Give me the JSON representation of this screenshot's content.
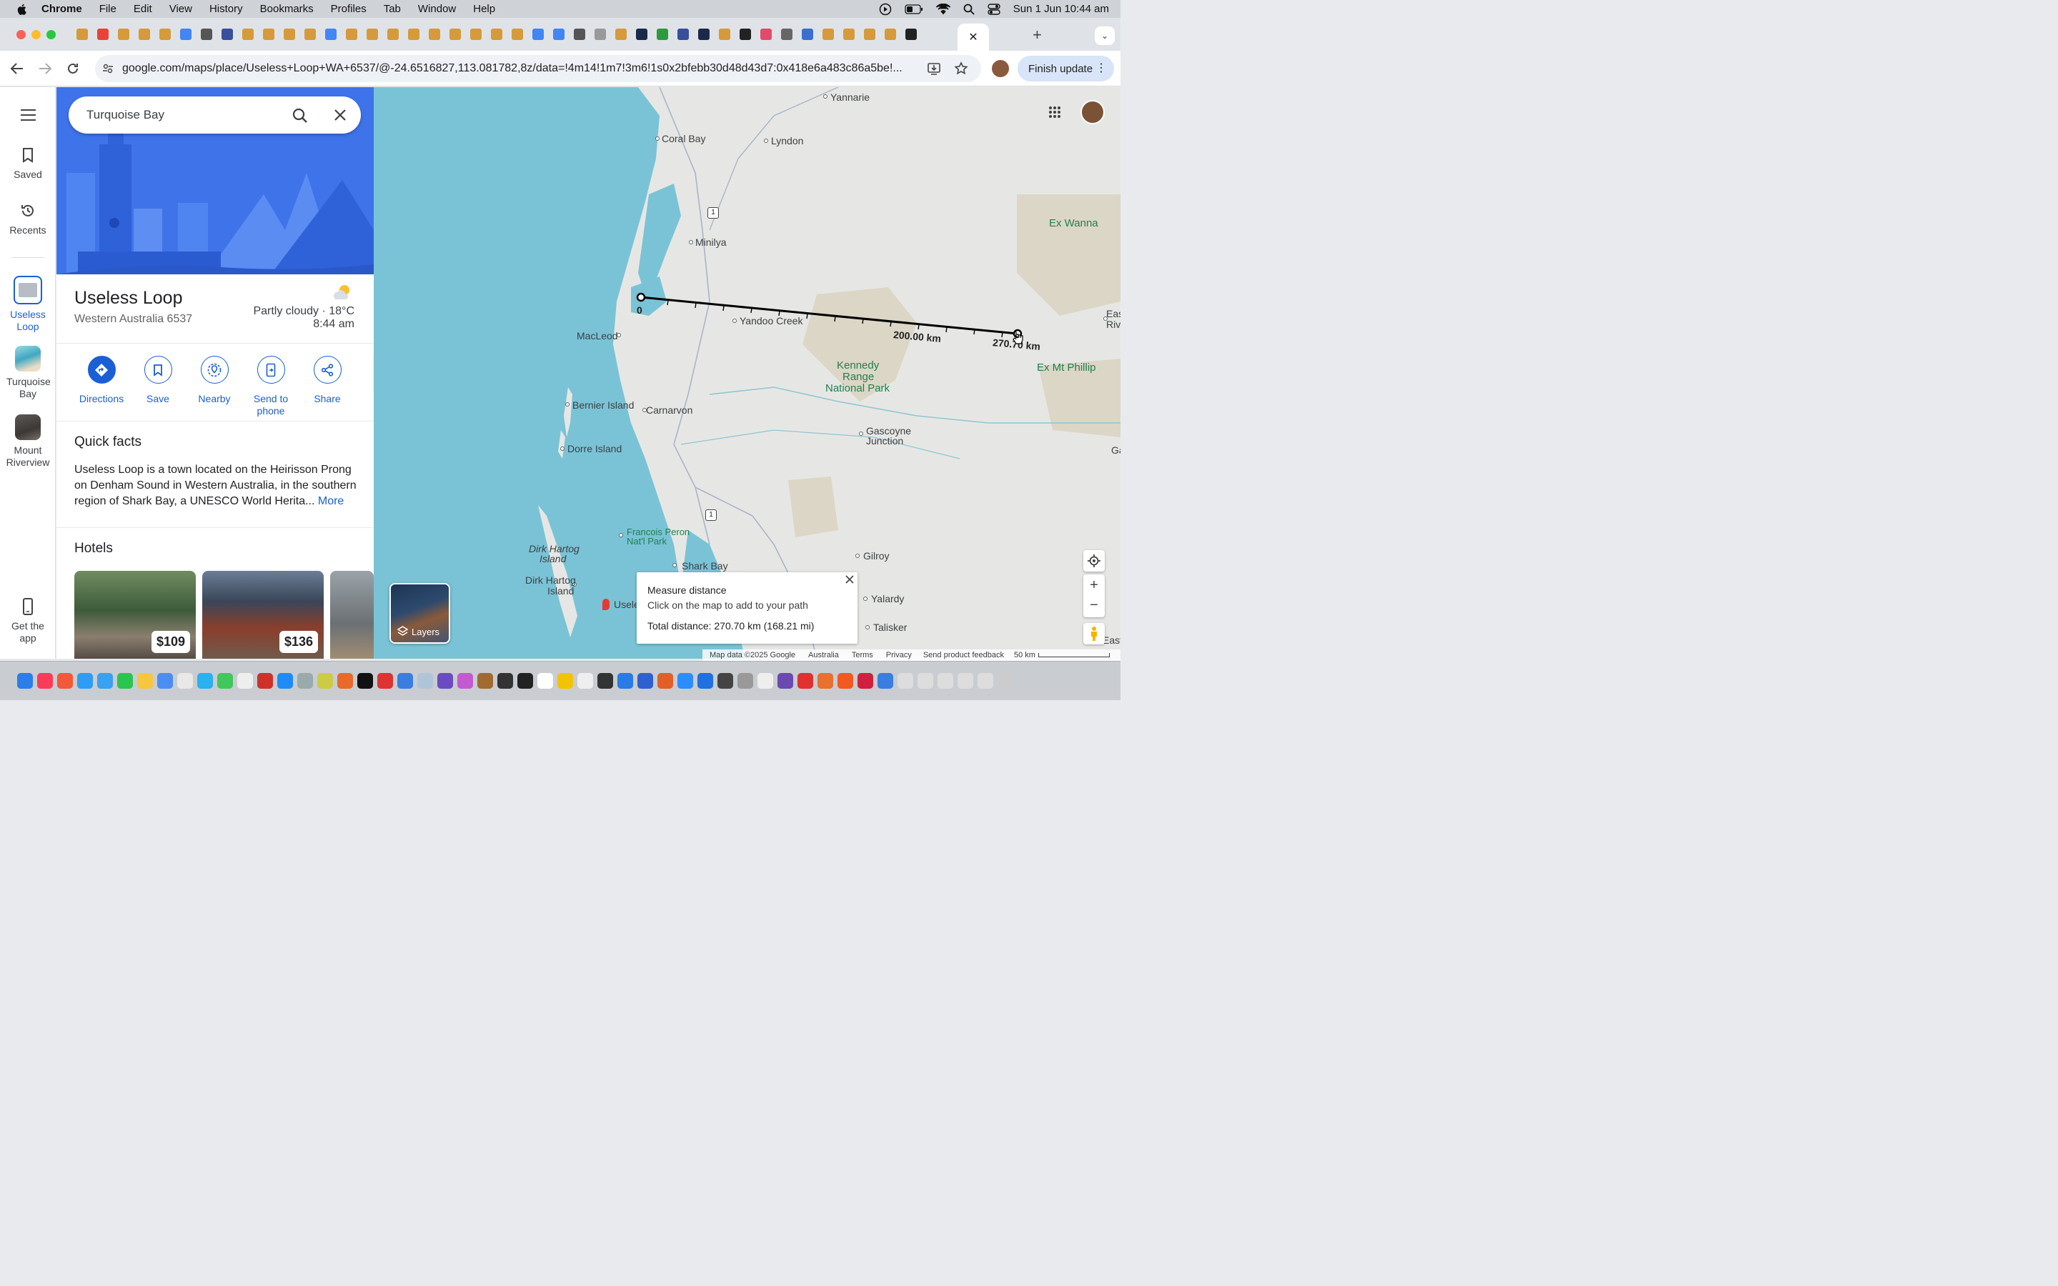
{
  "menubar": {
    "app": "Chrome",
    "items": [
      "File",
      "Edit",
      "View",
      "History",
      "Bookmarks",
      "Profiles",
      "Tab",
      "Window",
      "Help"
    ],
    "datetime": "Sun 1 Jun  10:44 am"
  },
  "browser": {
    "url": "google.com/maps/place/Useless+Loop+WA+6537/@-24.6516827,113.081782,8z/data=!4m14!1m7!3m6!1s0x2bfebb30d48d43d7:0x418e6a483c86a5be!...",
    "finish_update": "Finish update"
  },
  "rail": {
    "saved": "Saved",
    "recents": "Recents",
    "recent_places": [
      "Useless Loop",
      "Turquoise Bay",
      "Mount Riverview"
    ],
    "get_app": "Get the app"
  },
  "search": {
    "value": "Turquoise Bay"
  },
  "place": {
    "name": "Useless Loop",
    "address": "Western Australia 6537",
    "weather": "Partly cloudy · 18°C",
    "time": "8:44 am"
  },
  "actions": {
    "directions": "Directions",
    "save": "Save",
    "nearby": "Nearby",
    "send_line1": "Send to",
    "send_line2": "phone",
    "share": "Share"
  },
  "quick_facts": {
    "heading": "Quick facts",
    "text": "Useless Loop is a town located on the Heirisson Prong on Denham Sound in Western Australia, in the southern region of Shark Bay, a UNESCO World Herita...",
    "more": "More"
  },
  "hotels": {
    "heading": "Hotels",
    "prices": [
      "$109",
      "$136"
    ]
  },
  "map": {
    "places": {
      "yannarie": "Yannarie",
      "coral_bay": "Coral Bay",
      "lyndon": "Lyndon",
      "minilya": "Minilya",
      "ex_wanna": "Ex Wanna",
      "yandoo": "Yandoo Creek",
      "macleod": "MacLeod",
      "kennedy1": "Kennedy",
      "kennedy2": "Range",
      "kennedy3": "National Park",
      "ex_mt_phillip": "Ex Mt Phillip",
      "bernier": "Bernier Island",
      "carnarvon": "Carnarvon",
      "gascoyne1": "Gascoyne",
      "gascoyne2": "Junction",
      "dorre": "Dorre Island",
      "francois1": "Francois Peron",
      "francois2": "Nat'l Park",
      "dirk_it1": "Dirk Hartog",
      "dirk_it2": "Island",
      "dirk1": "Dirk Hartog",
      "dirk2": "Island",
      "shark_bay": "Shark Bay",
      "gilroy": "Gilroy",
      "yalardy": "Yalardy",
      "talisker": "Talisker",
      "useless": "Useles",
      "east": "East",
      "east_riv1": "Eas",
      "east_riv2": "Rive",
      "ga": "Ga"
    },
    "route_labels": [
      "1",
      "1"
    ],
    "measure_labels": {
      "start": "0",
      "mid": "200.00 km",
      "end": "270.70 km"
    },
    "measure_box": {
      "title": "Measure distance",
      "hint": "Click on the map to add to your path",
      "total": "Total distance: 270.70 km (168.21 mi)"
    },
    "layers": "Layers",
    "footer": [
      "Map data ©2025 Google",
      "Australia",
      "Terms",
      "Privacy",
      "Send product feedback",
      "50 km"
    ]
  }
}
